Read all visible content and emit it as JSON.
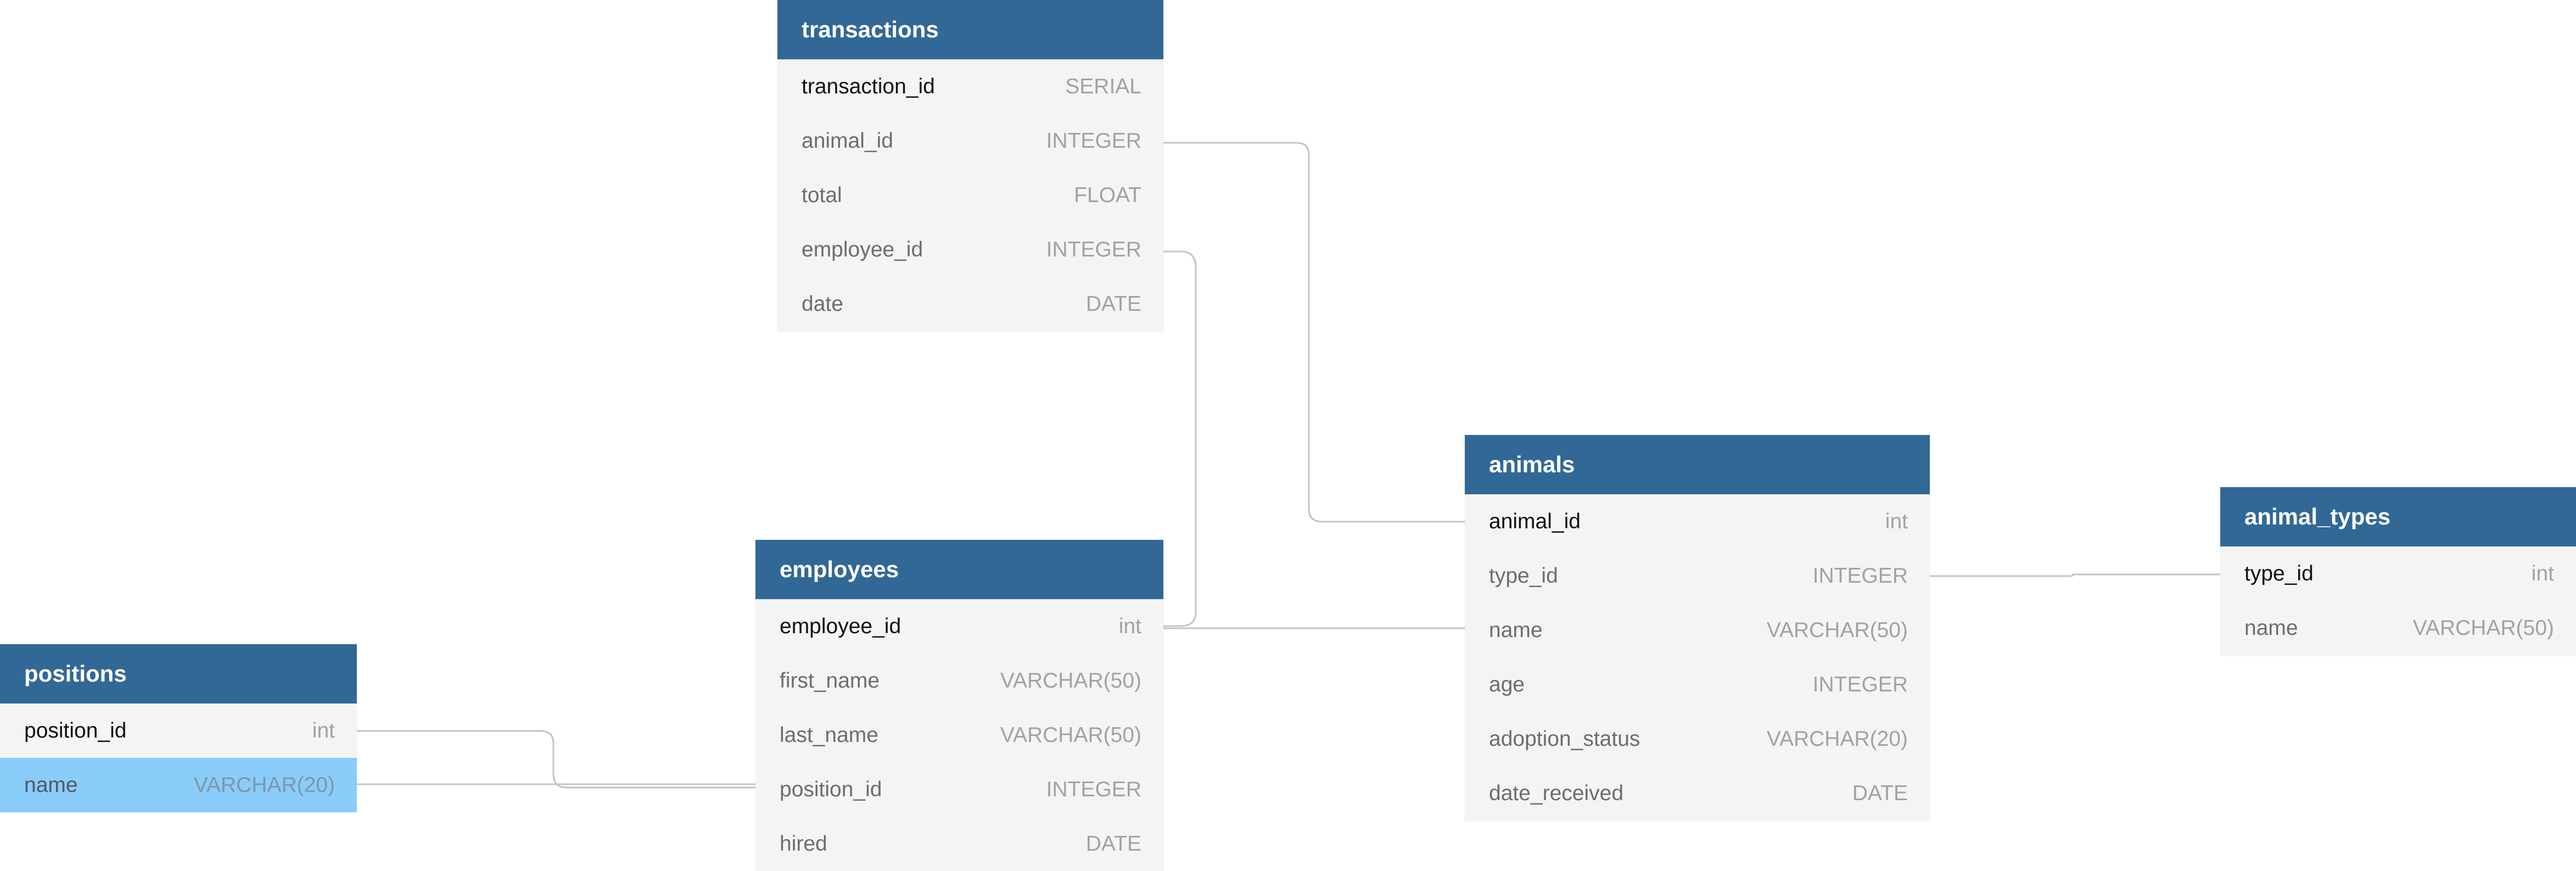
{
  "tables": {
    "transactions": {
      "title": "transactions",
      "columns": [
        {
          "name": "transaction_id",
          "type": "SERIAL"
        },
        {
          "name": "animal_id",
          "type": "INTEGER"
        },
        {
          "name": "total",
          "type": "FLOAT"
        },
        {
          "name": "employee_id",
          "type": "INTEGER"
        },
        {
          "name": "date",
          "type": "DATE"
        }
      ]
    },
    "animals": {
      "title": "animals",
      "columns": [
        {
          "name": "animal_id",
          "type": "int"
        },
        {
          "name": "type_id",
          "type": "INTEGER"
        },
        {
          "name": "name",
          "type": "VARCHAR(50)"
        },
        {
          "name": "age",
          "type": "INTEGER"
        },
        {
          "name": "adoption_status",
          "type": "VARCHAR(20)"
        },
        {
          "name": "date_received",
          "type": "DATE"
        }
      ]
    },
    "animal_types": {
      "title": "animal_types",
      "columns": [
        {
          "name": "type_id",
          "type": "int"
        },
        {
          "name": "name",
          "type": "VARCHAR(50)"
        }
      ]
    },
    "employees": {
      "title": "employees",
      "columns": [
        {
          "name": "employee_id",
          "type": "int"
        },
        {
          "name": "first_name",
          "type": "VARCHAR(50)"
        },
        {
          "name": "last_name",
          "type": "VARCHAR(50)"
        },
        {
          "name": "position_id",
          "type": "INTEGER"
        },
        {
          "name": "hired",
          "type": "DATE"
        }
      ]
    },
    "positions": {
      "title": "positions",
      "columns": [
        {
          "name": "position_id",
          "type": "int"
        },
        {
          "name": "name",
          "type": "VARCHAR(20)"
        }
      ]
    }
  },
  "colors": {
    "header": "#316896",
    "body": "#f4f4f4",
    "highlight": "#8accf9",
    "edge": "#c4c4c4"
  }
}
